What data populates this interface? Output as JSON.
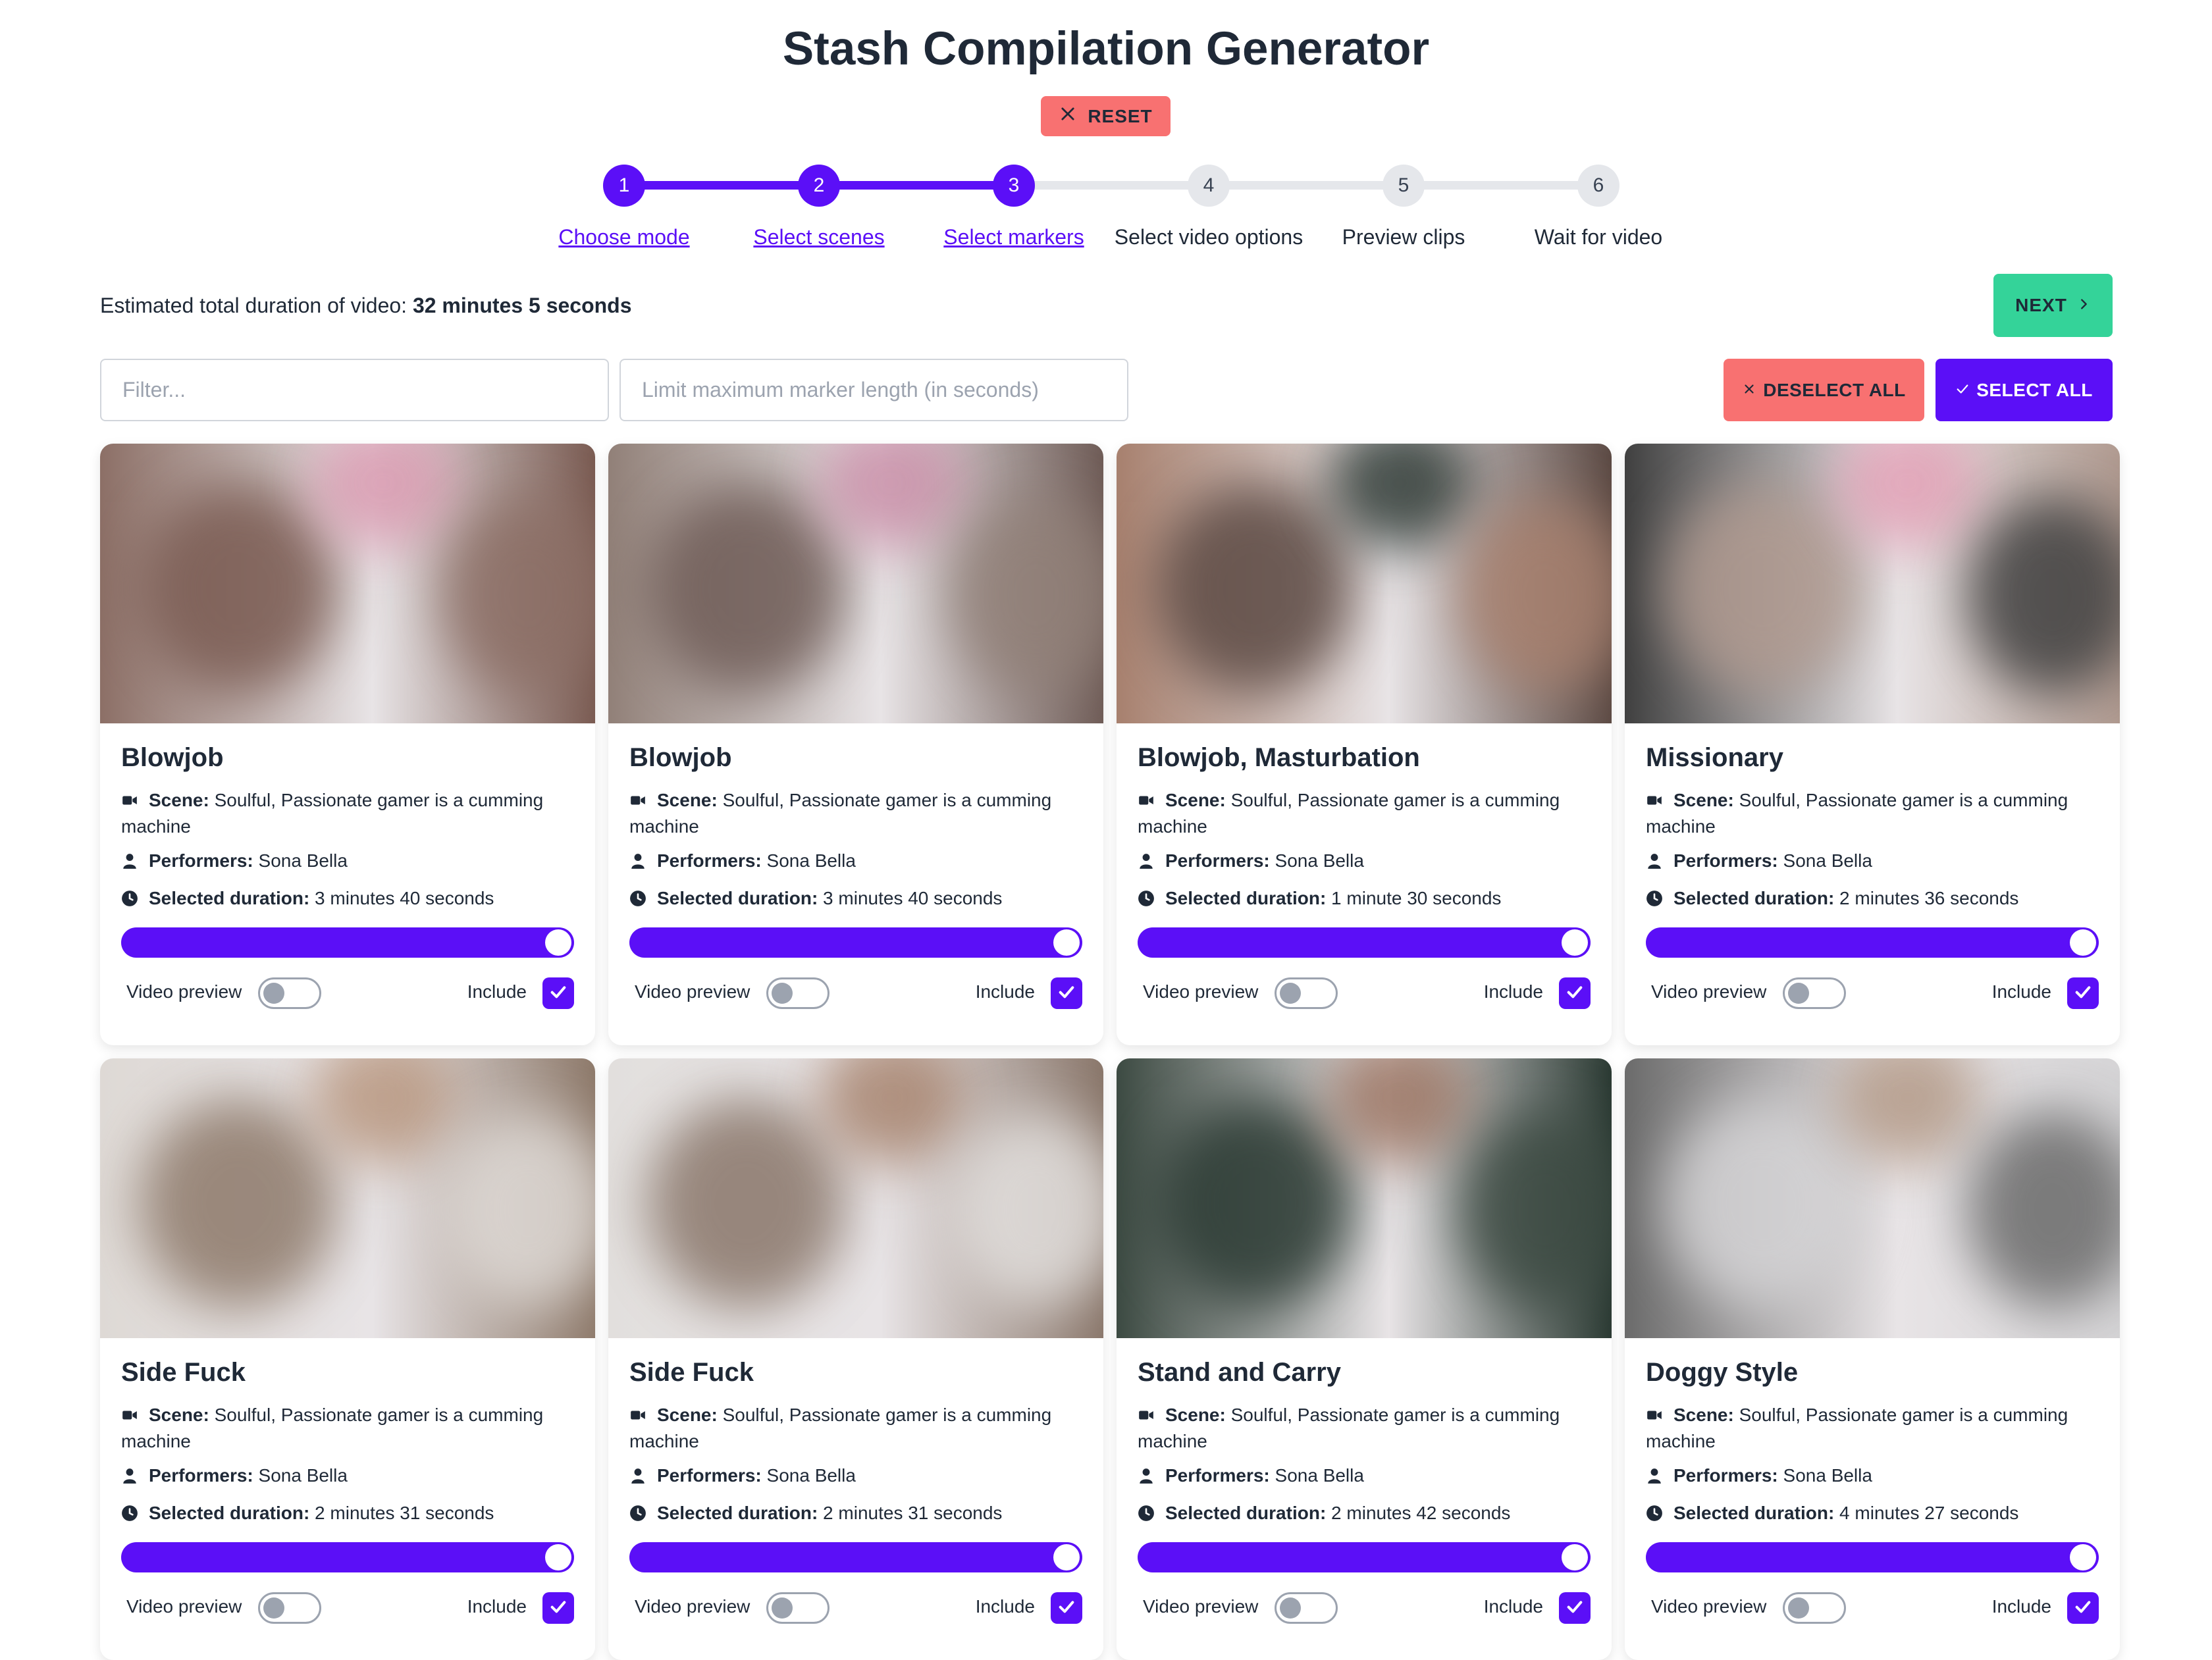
{
  "app": {
    "title": "Stash Compilation Generator",
    "reset_label": "RESET"
  },
  "steps": [
    {
      "number": "1",
      "label": "Choose mode",
      "state": "done"
    },
    {
      "number": "2",
      "label": "Select scenes",
      "state": "done"
    },
    {
      "number": "3",
      "label": "Select markers",
      "state": "done"
    },
    {
      "number": "4",
      "label": "Select video options",
      "state": "todo"
    },
    {
      "number": "5",
      "label": "Preview clips",
      "state": "todo"
    },
    {
      "number": "6",
      "label": "Wait for video",
      "state": "todo"
    }
  ],
  "summary": {
    "duration_prefix": "Estimated total duration of video:",
    "duration_value": "32 minutes 5 seconds",
    "next_label": "NEXT"
  },
  "filters": {
    "filter_placeholder": "Filter...",
    "filter_value": "",
    "limit_placeholder": "Limit maximum marker length (in seconds)",
    "limit_value": "",
    "deselect_all_label": "DESELECT ALL",
    "select_all_label": "SELECT ALL"
  },
  "labels": {
    "scene": "Scene:",
    "performers": "Performers:",
    "selected_duration": "Selected duration:",
    "video_preview": "Video preview",
    "include": "Include"
  },
  "colors": {
    "accent": "#5b0ff7",
    "danger": "#f87171",
    "success": "#34d399"
  },
  "markers": [
    {
      "title": "Blowjob",
      "scene": "Soulful, Passionate gamer is a cumming machine",
      "performers": "Sona Bella",
      "duration": "3 minutes 40 seconds",
      "range_fraction": 1.0,
      "video_preview": false,
      "include": true
    },
    {
      "title": "Blowjob",
      "scene": "Soulful, Passionate gamer is a cumming machine",
      "performers": "Sona Bella",
      "duration": "3 minutes 40 seconds",
      "range_fraction": 1.0,
      "video_preview": false,
      "include": true
    },
    {
      "title": "Blowjob, Masturbation",
      "scene": "Soulful, Passionate gamer is a cumming machine",
      "performers": "Sona Bella",
      "duration": "1 minute 30 seconds",
      "range_fraction": 1.0,
      "video_preview": false,
      "include": true
    },
    {
      "title": "Missionary",
      "scene": "Soulful, Passionate gamer is a cumming machine",
      "performers": "Sona Bella",
      "duration": "2 minutes 36 seconds",
      "range_fraction": 1.0,
      "video_preview": false,
      "include": true
    },
    {
      "title": "Side Fuck",
      "scene": "Soulful, Passionate gamer is a cumming machine",
      "performers": "Sona Bella",
      "duration": "2 minutes 31 seconds",
      "range_fraction": 1.0,
      "video_preview": false,
      "include": true
    },
    {
      "title": "Side Fuck",
      "scene": "Soulful, Passionate gamer is a cumming machine",
      "performers": "Sona Bella",
      "duration": "2 minutes 31 seconds",
      "range_fraction": 1.0,
      "video_preview": false,
      "include": true
    },
    {
      "title": "Stand and Carry",
      "scene": "Soulful, Passionate gamer is a cumming machine",
      "performers": "Sona Bella",
      "duration": "2 minutes 42 seconds",
      "range_fraction": 1.0,
      "video_preview": false,
      "include": true
    },
    {
      "title": "Doggy Style",
      "scene": "Soulful, Passionate gamer is a cumming machine",
      "performers": "Sona Bella",
      "duration": "4 minutes 27 seconds",
      "range_fraction": 1.0,
      "video_preview": false,
      "include": true
    }
  ]
}
